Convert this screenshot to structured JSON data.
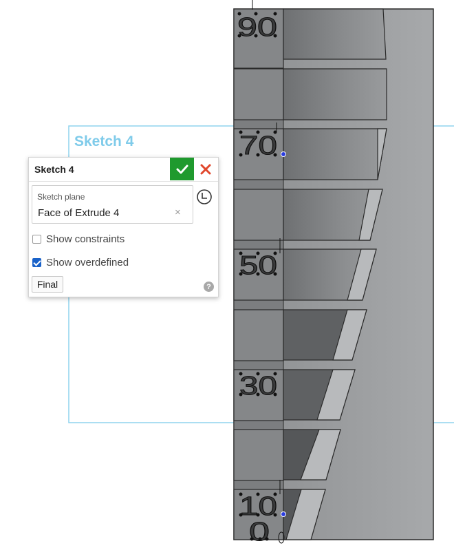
{
  "sketch_label": "Sketch 4",
  "model_labels": {
    "n90": "90",
    "n70": "70",
    "n50": "50",
    "n30": "30",
    "n10": "10",
    "n0": "0"
  },
  "dialog": {
    "title": "Sketch 4",
    "accept_icon": "check-icon",
    "cancel_icon": "close-icon",
    "sketch_plane": {
      "label": "Sketch plane",
      "value": "Face of Extrude 4",
      "clear_icon": "×"
    },
    "show_constraints": {
      "label": "Show constraints",
      "checked": false
    },
    "show_overdefined": {
      "label": "Show overdefined",
      "checked": true
    },
    "final_button": "Final",
    "help_icon": "?"
  },
  "colors": {
    "accept": "#1f9a2e",
    "cancel": "#e0472c",
    "sketch_outline": "#8fd3ee",
    "sketch_label": "#7fcbea",
    "checkbox": "#1a62c9"
  }
}
